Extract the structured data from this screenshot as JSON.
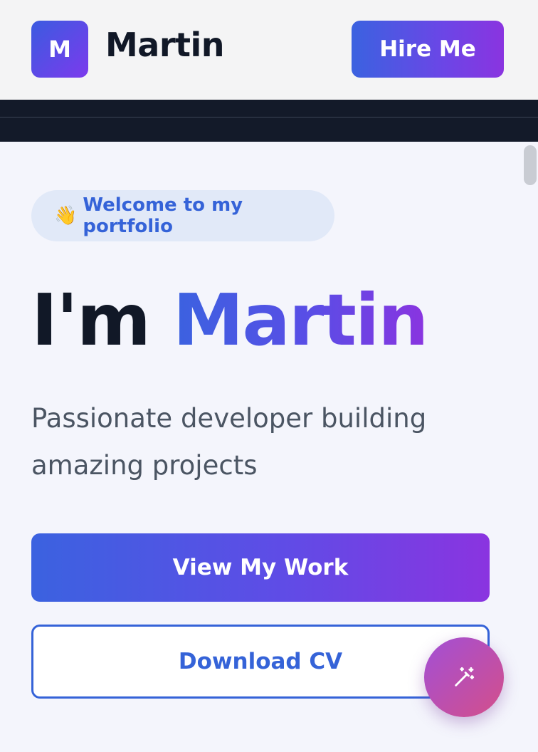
{
  "header": {
    "logo_letter": "M",
    "brand_name": "Martin",
    "hire_button": "Hire Me"
  },
  "hero": {
    "welcome_emoji": "👋",
    "welcome_text": "Welcome to my portfolio",
    "headline_prefix": "I'm",
    "headline_name": "Martin",
    "subtitle": "Passionate developer building amazing projects",
    "primary_button": "View My Work",
    "secondary_button": "Download CV"
  },
  "fab": {
    "icon": "magic-wand-icon"
  },
  "colors": {
    "accent_blue": "#3563d8",
    "accent_purple": "#8a34e0",
    "fab_pink": "#d44f8a",
    "text_dark": "#111827"
  }
}
